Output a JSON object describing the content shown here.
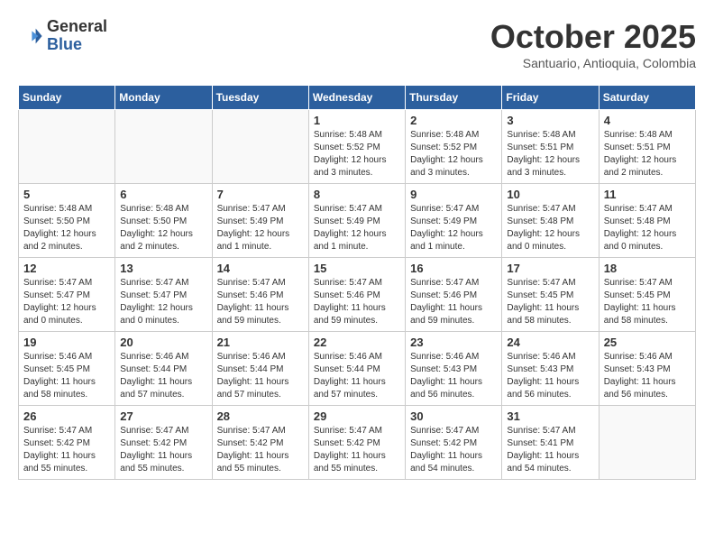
{
  "header": {
    "logo_line1": "General",
    "logo_line2": "Blue",
    "month": "October 2025",
    "location": "Santuario, Antioquia, Colombia"
  },
  "weekdays": [
    "Sunday",
    "Monday",
    "Tuesday",
    "Wednesday",
    "Thursday",
    "Friday",
    "Saturday"
  ],
  "weeks": [
    [
      {
        "day": "",
        "info": ""
      },
      {
        "day": "",
        "info": ""
      },
      {
        "day": "",
        "info": ""
      },
      {
        "day": "1",
        "info": "Sunrise: 5:48 AM\nSunset: 5:52 PM\nDaylight: 12 hours\nand 3 minutes."
      },
      {
        "day": "2",
        "info": "Sunrise: 5:48 AM\nSunset: 5:52 PM\nDaylight: 12 hours\nand 3 minutes."
      },
      {
        "day": "3",
        "info": "Sunrise: 5:48 AM\nSunset: 5:51 PM\nDaylight: 12 hours\nand 3 minutes."
      },
      {
        "day": "4",
        "info": "Sunrise: 5:48 AM\nSunset: 5:51 PM\nDaylight: 12 hours\nand 2 minutes."
      }
    ],
    [
      {
        "day": "5",
        "info": "Sunrise: 5:48 AM\nSunset: 5:50 PM\nDaylight: 12 hours\nand 2 minutes."
      },
      {
        "day": "6",
        "info": "Sunrise: 5:48 AM\nSunset: 5:50 PM\nDaylight: 12 hours\nand 2 minutes."
      },
      {
        "day": "7",
        "info": "Sunrise: 5:47 AM\nSunset: 5:49 PM\nDaylight: 12 hours\nand 1 minute."
      },
      {
        "day": "8",
        "info": "Sunrise: 5:47 AM\nSunset: 5:49 PM\nDaylight: 12 hours\nand 1 minute."
      },
      {
        "day": "9",
        "info": "Sunrise: 5:47 AM\nSunset: 5:49 PM\nDaylight: 12 hours\nand 1 minute."
      },
      {
        "day": "10",
        "info": "Sunrise: 5:47 AM\nSunset: 5:48 PM\nDaylight: 12 hours\nand 0 minutes."
      },
      {
        "day": "11",
        "info": "Sunrise: 5:47 AM\nSunset: 5:48 PM\nDaylight: 12 hours\nand 0 minutes."
      }
    ],
    [
      {
        "day": "12",
        "info": "Sunrise: 5:47 AM\nSunset: 5:47 PM\nDaylight: 12 hours\nand 0 minutes."
      },
      {
        "day": "13",
        "info": "Sunrise: 5:47 AM\nSunset: 5:47 PM\nDaylight: 12 hours\nand 0 minutes."
      },
      {
        "day": "14",
        "info": "Sunrise: 5:47 AM\nSunset: 5:46 PM\nDaylight: 11 hours\nand 59 minutes."
      },
      {
        "day": "15",
        "info": "Sunrise: 5:47 AM\nSunset: 5:46 PM\nDaylight: 11 hours\nand 59 minutes."
      },
      {
        "day": "16",
        "info": "Sunrise: 5:47 AM\nSunset: 5:46 PM\nDaylight: 11 hours\nand 59 minutes."
      },
      {
        "day": "17",
        "info": "Sunrise: 5:47 AM\nSunset: 5:45 PM\nDaylight: 11 hours\nand 58 minutes."
      },
      {
        "day": "18",
        "info": "Sunrise: 5:47 AM\nSunset: 5:45 PM\nDaylight: 11 hours\nand 58 minutes."
      }
    ],
    [
      {
        "day": "19",
        "info": "Sunrise: 5:46 AM\nSunset: 5:45 PM\nDaylight: 11 hours\nand 58 minutes."
      },
      {
        "day": "20",
        "info": "Sunrise: 5:46 AM\nSunset: 5:44 PM\nDaylight: 11 hours\nand 57 minutes."
      },
      {
        "day": "21",
        "info": "Sunrise: 5:46 AM\nSunset: 5:44 PM\nDaylight: 11 hours\nand 57 minutes."
      },
      {
        "day": "22",
        "info": "Sunrise: 5:46 AM\nSunset: 5:44 PM\nDaylight: 11 hours\nand 57 minutes."
      },
      {
        "day": "23",
        "info": "Sunrise: 5:46 AM\nSunset: 5:43 PM\nDaylight: 11 hours\nand 56 minutes."
      },
      {
        "day": "24",
        "info": "Sunrise: 5:46 AM\nSunset: 5:43 PM\nDaylight: 11 hours\nand 56 minutes."
      },
      {
        "day": "25",
        "info": "Sunrise: 5:46 AM\nSunset: 5:43 PM\nDaylight: 11 hours\nand 56 minutes."
      }
    ],
    [
      {
        "day": "26",
        "info": "Sunrise: 5:47 AM\nSunset: 5:42 PM\nDaylight: 11 hours\nand 55 minutes."
      },
      {
        "day": "27",
        "info": "Sunrise: 5:47 AM\nSunset: 5:42 PM\nDaylight: 11 hours\nand 55 minutes."
      },
      {
        "day": "28",
        "info": "Sunrise: 5:47 AM\nSunset: 5:42 PM\nDaylight: 11 hours\nand 55 minutes."
      },
      {
        "day": "29",
        "info": "Sunrise: 5:47 AM\nSunset: 5:42 PM\nDaylight: 11 hours\nand 55 minutes."
      },
      {
        "day": "30",
        "info": "Sunrise: 5:47 AM\nSunset: 5:42 PM\nDaylight: 11 hours\nand 54 minutes."
      },
      {
        "day": "31",
        "info": "Sunrise: 5:47 AM\nSunset: 5:41 PM\nDaylight: 11 hours\nand 54 minutes."
      },
      {
        "day": "",
        "info": ""
      }
    ]
  ]
}
